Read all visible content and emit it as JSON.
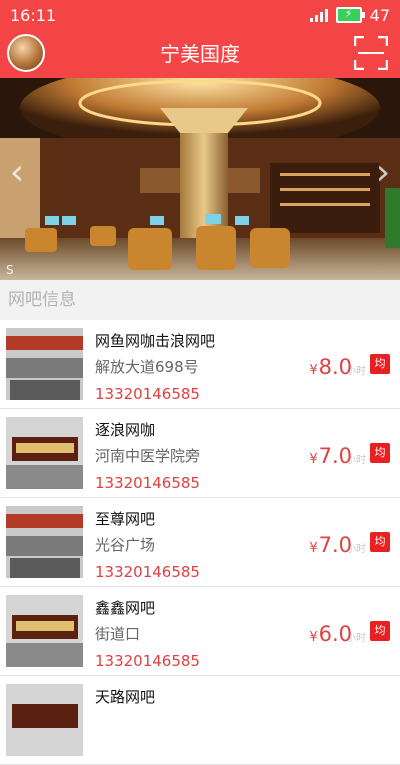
{
  "status": {
    "time": "16:11",
    "battery": "47"
  },
  "header": {
    "title": "宁美国度"
  },
  "section": {
    "title": "网吧信息"
  },
  "cafes": [
    {
      "name": "网鱼网咖击浪网吧",
      "address": "解放大道698号",
      "phone": "13320146585",
      "price": "8.0",
      "unit": "小时",
      "badge": "均",
      "currency": "¥"
    },
    {
      "name": "逐浪网咖",
      "address": "河南中医学院旁",
      "phone": "13320146585",
      "price": "7.0",
      "unit": "小时",
      "badge": "均",
      "currency": "¥"
    },
    {
      "name": "至尊网吧",
      "address": "光谷广场",
      "phone": "13320146585",
      "price": "7.0",
      "unit": "小时",
      "badge": "均",
      "currency": "¥"
    },
    {
      "name": "鑫鑫网吧",
      "address": "街道口",
      "phone": "13320146585",
      "price": "6.0",
      "unit": "小时",
      "badge": "均",
      "currency": "¥"
    },
    {
      "name": "天路网吧",
      "address": "",
      "phone": "",
      "price": "",
      "unit": "",
      "badge": "",
      "currency": ""
    }
  ],
  "icons": {
    "scan": "scan-icon",
    "prev": "chevron-left-icon",
    "next": "chevron-right-icon"
  },
  "colors": {
    "brand": "#f34545",
    "price": "#e04040",
    "badge": "#e82020"
  }
}
